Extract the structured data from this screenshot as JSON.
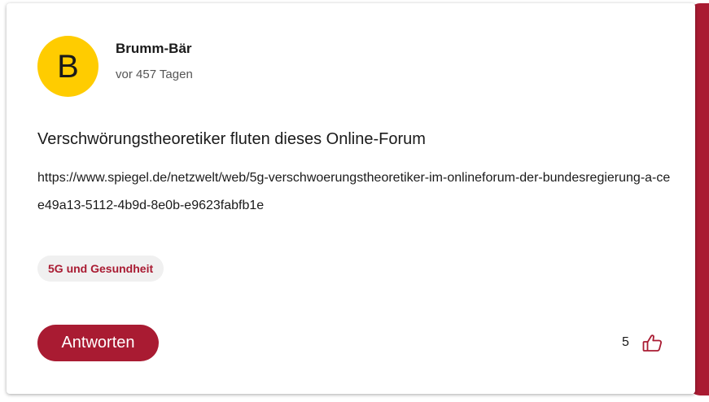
{
  "post": {
    "avatar_letter": "B",
    "author": "Brumm-Bär",
    "time": "vor 457 Tagen",
    "title": "Verschwörungstheoretiker fluten dieses Online-Forum",
    "body": "https://www.spiegel.de/netzwelt/web/5g-verschwoerungstheoretiker-im-onlineforum-der-bundesregierung-a-cee49a13-5112-4b9d-8e0b-e9623fabfb1e",
    "tag": "5G und Gesundheit",
    "reply_label": "Antworten",
    "like_count": "5"
  },
  "colors": {
    "accent": "#a91b32",
    "avatar_bg": "#ffcc00",
    "tag_bg": "#f0f0f0"
  },
  "icons": {
    "like": "thumbs-up-icon"
  }
}
